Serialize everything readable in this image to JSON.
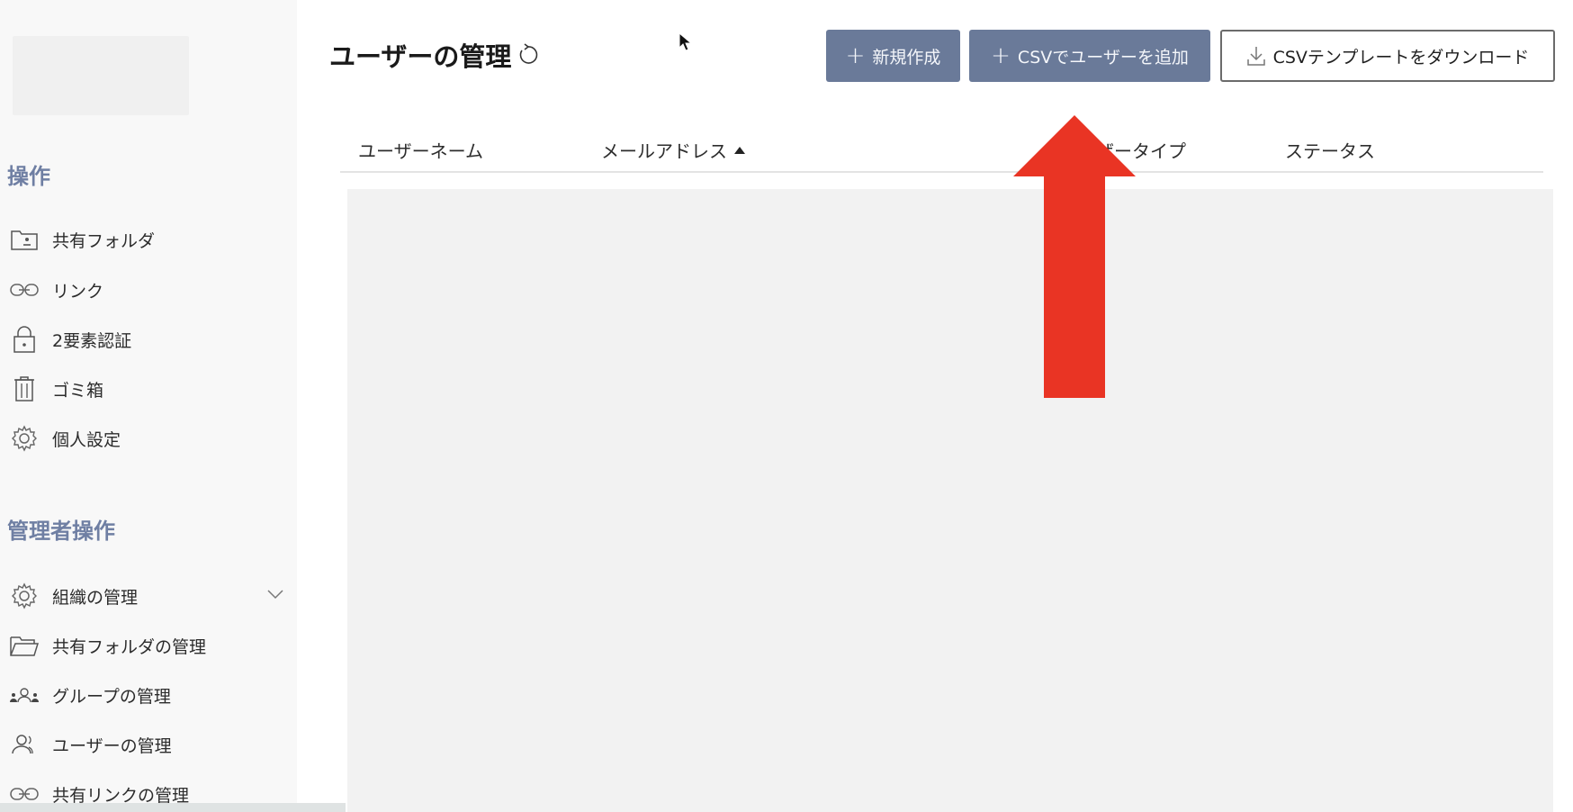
{
  "sidebar": {
    "sections": {
      "operations": "操作",
      "admin": "管理者操作"
    },
    "items": [
      {
        "label": "共有フォルダ",
        "icon": "shared-folder-icon"
      },
      {
        "label": "リンク",
        "icon": "link-icon"
      },
      {
        "label": "2要素認証",
        "icon": "lock-icon"
      },
      {
        "label": "ゴミ箱",
        "icon": "trash-icon"
      },
      {
        "label": "個人設定",
        "icon": "gear-icon"
      }
    ],
    "admin_items": [
      {
        "label": "組織の管理",
        "icon": "gear-icon",
        "expandable": true
      },
      {
        "label": "共有フォルダの管理",
        "icon": "folder-open-icon"
      },
      {
        "label": "グループの管理",
        "icon": "group-icon"
      },
      {
        "label": "ユーザーの管理",
        "icon": "user-icon"
      },
      {
        "label": "共有リンクの管理",
        "icon": "link-icon"
      }
    ]
  },
  "main": {
    "title": "ユーザーの管理",
    "buttons": {
      "new": "新規作成",
      "csv_add": "CSVでユーザーを追加",
      "csv_template": "CSVテンプレートをダウンロード"
    },
    "columns": {
      "username": "ユーザーネーム",
      "email": "メールアドレス",
      "usertype": "ザータイプ",
      "status": "ステータス"
    }
  },
  "colors": {
    "accent": "#6a7a99",
    "section_title": "#6f7fa3",
    "arrow": "#e93424"
  }
}
